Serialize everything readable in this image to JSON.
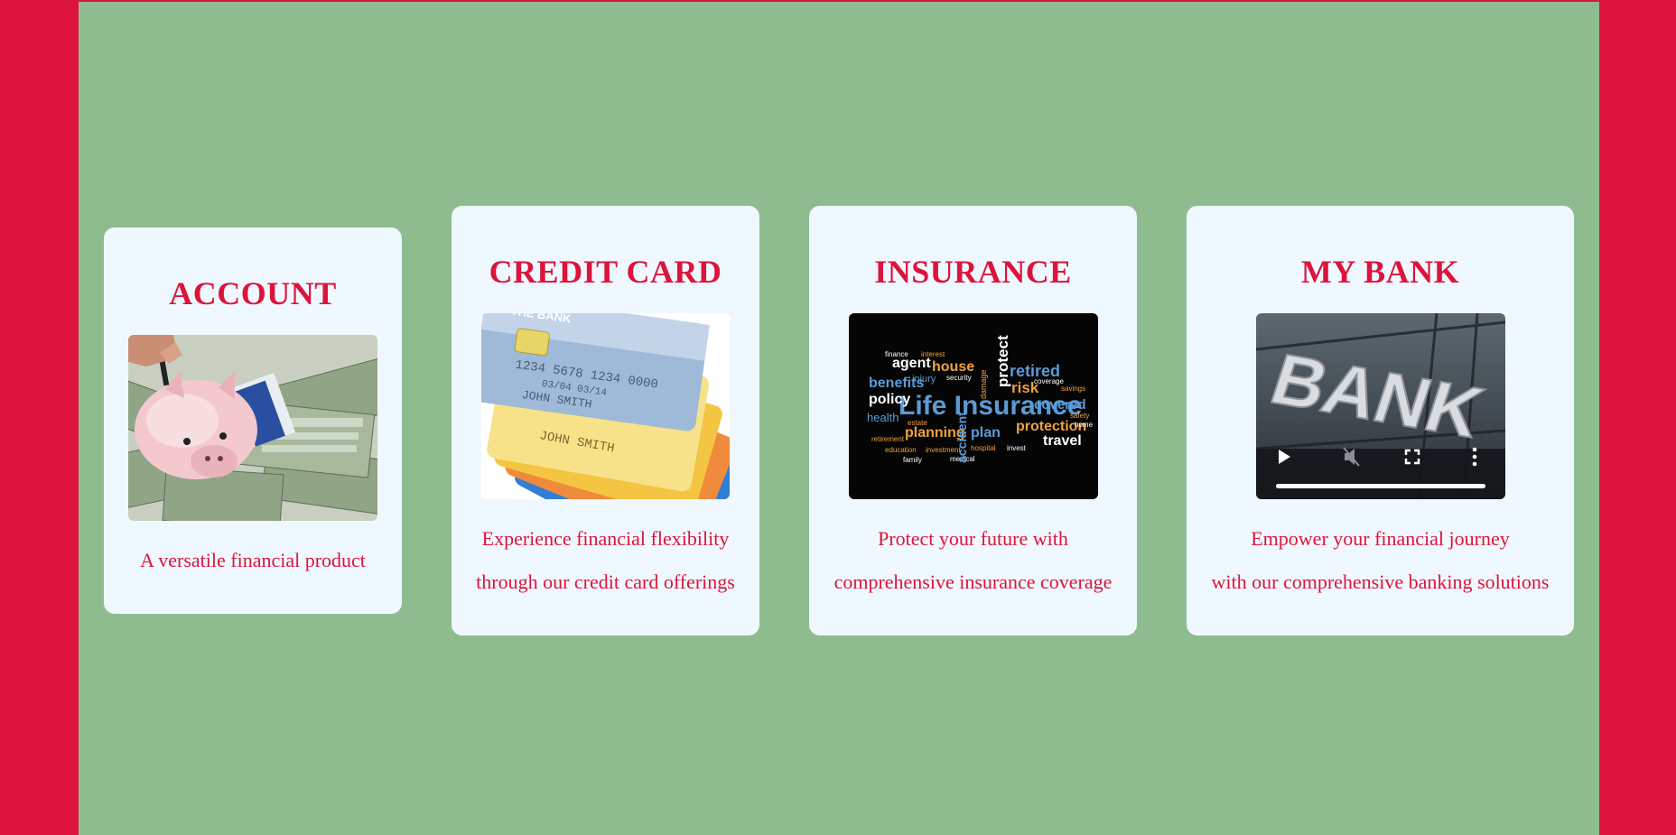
{
  "cards": [
    {
      "title": "ACCOUNT",
      "image": "piggy-bank-money",
      "text_lines": [
        "A versatile financial product"
      ]
    },
    {
      "title": "CREDIT CARD",
      "image": "credit-cards",
      "text_lines": [
        "Experience financial flexibility",
        "through our credit card offerings"
      ],
      "card_text": {
        "brand": "THE BANK",
        "number": "1234 5678 1234 0000",
        "name": "JOHN SMITH",
        "dates": "03/04 03/14"
      }
    },
    {
      "title": "INSURANCE",
      "image": "life-insurance-word-cloud",
      "text_lines": [
        "Protect your future with",
        "comprehensive insurance coverage"
      ],
      "words": [
        "Life Insurance",
        "agent",
        "house",
        "benefits",
        "policy",
        "retired",
        "risk",
        "protect",
        "planning",
        "plan",
        "protection",
        "covered",
        "travel",
        "health",
        "accident",
        "finance",
        "interest",
        "security",
        "injury",
        "coverage",
        "savings",
        "medical",
        "family",
        "education",
        "retirement",
        "estate",
        "investment",
        "hospital",
        "invest",
        "safety",
        "home",
        "damage"
      ]
    },
    {
      "title": "MY BANK",
      "image": "bank-building-video",
      "text_lines": [
        "Empower your financial journey",
        "with our comprehensive banking solutions"
      ],
      "video_text": "BANK"
    }
  ],
  "colors": {
    "accent": "#DC143C",
    "background": "#8FBC8F",
    "card": "#F0F8FF"
  }
}
